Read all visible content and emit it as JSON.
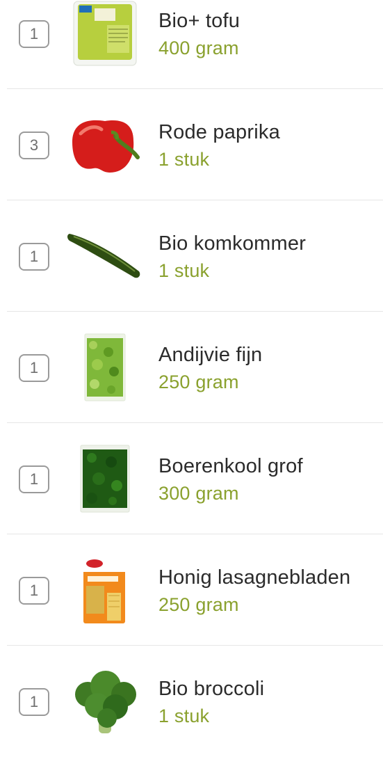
{
  "accent_color": "#8aa12e",
  "items": [
    {
      "qty": "1",
      "name": "Bio+ tofu",
      "amount": "400 gram",
      "icon": "tofu-package-icon"
    },
    {
      "qty": "3",
      "name": "Rode paprika",
      "amount": "1 stuk",
      "icon": "red-pepper-icon"
    },
    {
      "qty": "1",
      "name": "Bio komkommer",
      "amount": "1 stuk",
      "icon": "cucumber-icon"
    },
    {
      "qty": "1",
      "name": "Andijvie fijn",
      "amount": "250 gram",
      "icon": "endive-bag-icon"
    },
    {
      "qty": "1",
      "name": "Boerenkool grof",
      "amount": "300 gram",
      "icon": "kale-bag-icon"
    },
    {
      "qty": "1",
      "name": "Honig lasagnebladen",
      "amount": "250 gram",
      "icon": "lasagna-box-icon"
    },
    {
      "qty": "1",
      "name": "Bio broccoli",
      "amount": "1 stuk",
      "icon": "broccoli-icon"
    }
  ]
}
